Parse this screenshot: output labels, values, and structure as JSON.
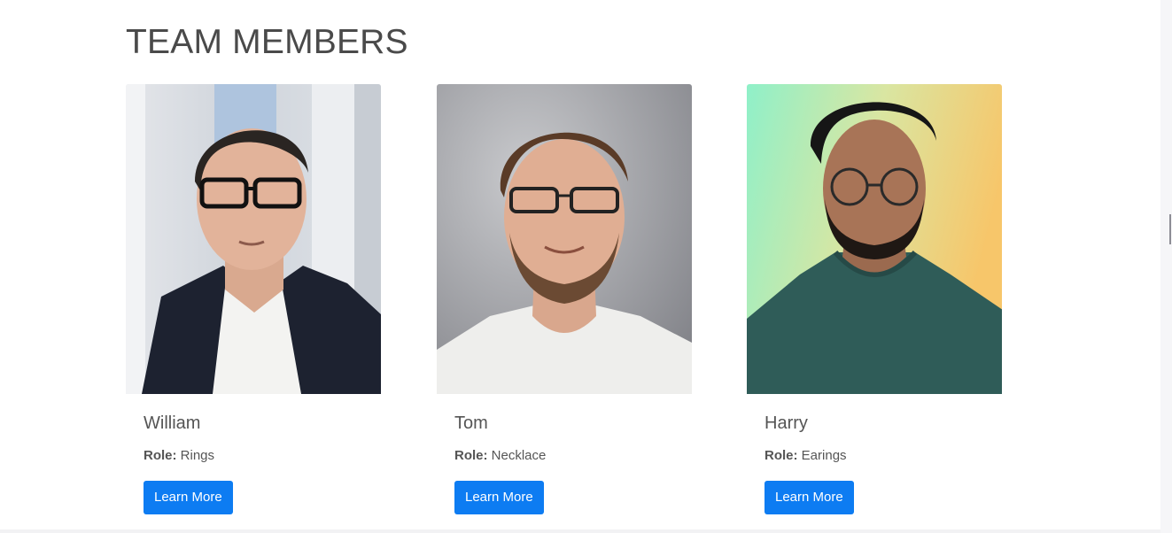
{
  "section": {
    "title": "TEAM MEMBERS"
  },
  "role_key_label": "Role:",
  "members": [
    {
      "name": "William",
      "role": "Rings",
      "button_label": "Learn More"
    },
    {
      "name": "Tom",
      "role": "Necklace",
      "button_label": "Learn More"
    },
    {
      "name": "Harry",
      "role": "Earings",
      "button_label": "Learn More"
    }
  ],
  "colors": {
    "accent": "#0d7cf2",
    "title_text": "#4a4a4a",
    "body_text": "#555555"
  }
}
